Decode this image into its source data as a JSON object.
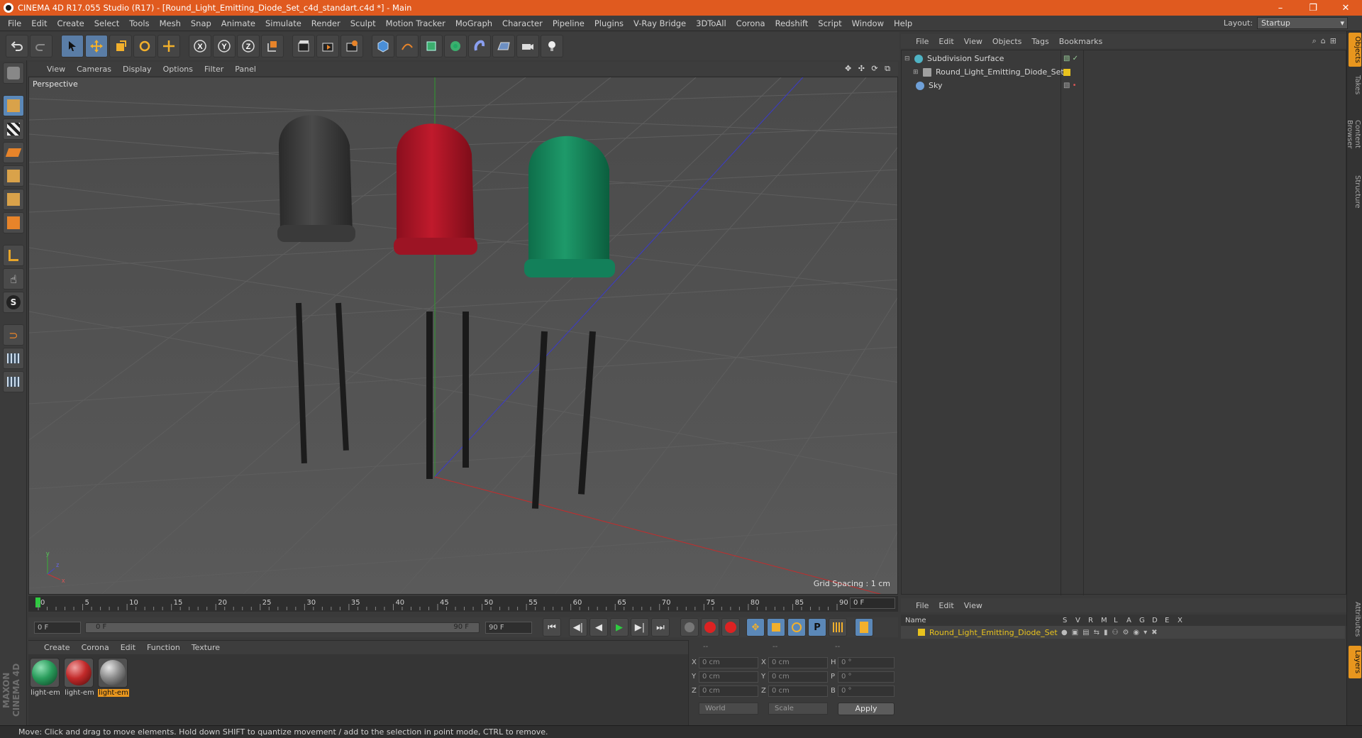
{
  "app": {
    "title": "CINEMA 4D R17.055 Studio (R17) - [Round_Light_Emitting_Diode_Set_c4d_standart.c4d *] - Main",
    "window_buttons": [
      "–",
      "❐",
      "✕"
    ]
  },
  "menubar": {
    "items": [
      "File",
      "Edit",
      "Create",
      "Select",
      "Tools",
      "Mesh",
      "Snap",
      "Animate",
      "Simulate",
      "Render",
      "Sculpt",
      "Motion Tracker",
      "MoGraph",
      "Character",
      "Pipeline",
      "Plugins",
      "V-Ray Bridge",
      "3DToAll",
      "Corona",
      "Redshift",
      "Script",
      "Window",
      "Help"
    ],
    "layout_label": "Layout:",
    "layout_value": "Startup"
  },
  "viewport": {
    "menu": [
      "View",
      "Cameras",
      "Display",
      "Options",
      "Filter",
      "Panel"
    ],
    "label": "Perspective",
    "grid_spacing": "Grid Spacing : 1 cm",
    "nav_icons": "✥ ✣ ⟳ ⧉",
    "axis_labels": [
      "y",
      "x",
      "z"
    ]
  },
  "timeline": {
    "ticks": [
      "0",
      "5",
      "10",
      "15",
      "20",
      "25",
      "30",
      "35",
      "40",
      "45",
      "50",
      "55",
      "60",
      "65",
      "70",
      "75",
      "80",
      "85",
      "90"
    ],
    "current_frame": "0 F",
    "start_field": "0 F",
    "range_start": "0 F",
    "range_end": "90 F",
    "end_field": "90 F"
  },
  "transport": {
    "buttons": [
      "⏮",
      "◀|",
      "◀",
      "▶",
      "▶|",
      "⏭"
    ]
  },
  "materials": {
    "menu": [
      "Create",
      "Corona",
      "Edit",
      "Function",
      "Texture"
    ],
    "items": [
      {
        "label": "light-em",
        "color": "#2a9d5c"
      },
      {
        "label": "light-em",
        "color": "#c22a2a"
      },
      {
        "label": "light-em",
        "color": "#8a8a8a"
      }
    ]
  },
  "coordinates": {
    "headers": [
      "--",
      "--",
      "--"
    ],
    "rows": [
      {
        "a": "X",
        "av": "0 cm",
        "b": "X",
        "bv": "0 cm",
        "c": "H",
        "cv": "0 °"
      },
      {
        "a": "Y",
        "av": "0 cm",
        "b": "Y",
        "bv": "0 cm",
        "c": "P",
        "cv": "0 °"
      },
      {
        "a": "Z",
        "av": "0 cm",
        "b": "Z",
        "bv": "0 cm",
        "c": "B",
        "cv": "0 °"
      }
    ],
    "mode": "World",
    "transform": "Scale",
    "apply": "Apply"
  },
  "object_manager": {
    "menu": [
      "File",
      "Edit",
      "View",
      "Objects",
      "Tags",
      "Bookmarks"
    ],
    "objects": [
      {
        "name": "Subdivision Surface",
        "icon_color": "#4fb3c4"
      },
      {
        "name": "Round_Light_Emitting_Diode_Set",
        "icon_color": "#a0a0a0"
      },
      {
        "name": "Sky",
        "icon_color": "#6fa0d8"
      }
    ]
  },
  "layer_manager": {
    "menu": [
      "File",
      "Edit",
      "View"
    ],
    "columns": [
      "Name",
      "S",
      "V",
      "R",
      "M",
      "L",
      "A",
      "G",
      "D",
      "E",
      "X"
    ],
    "layers": [
      {
        "name": "Round_Light_Emitting_Diode_Set",
        "color": "#e8c21e"
      }
    ]
  },
  "right_tabs": [
    "Objects",
    "Takes",
    "Content Browser",
    "Structure",
    "Attributes",
    "Layers"
  ],
  "status": "Move: Click and drag to move elements. Hold down SHIFT to quantize movement / add to the selection in point mode, CTRL to remove.",
  "brand": "MAXON CINEMA 4D"
}
